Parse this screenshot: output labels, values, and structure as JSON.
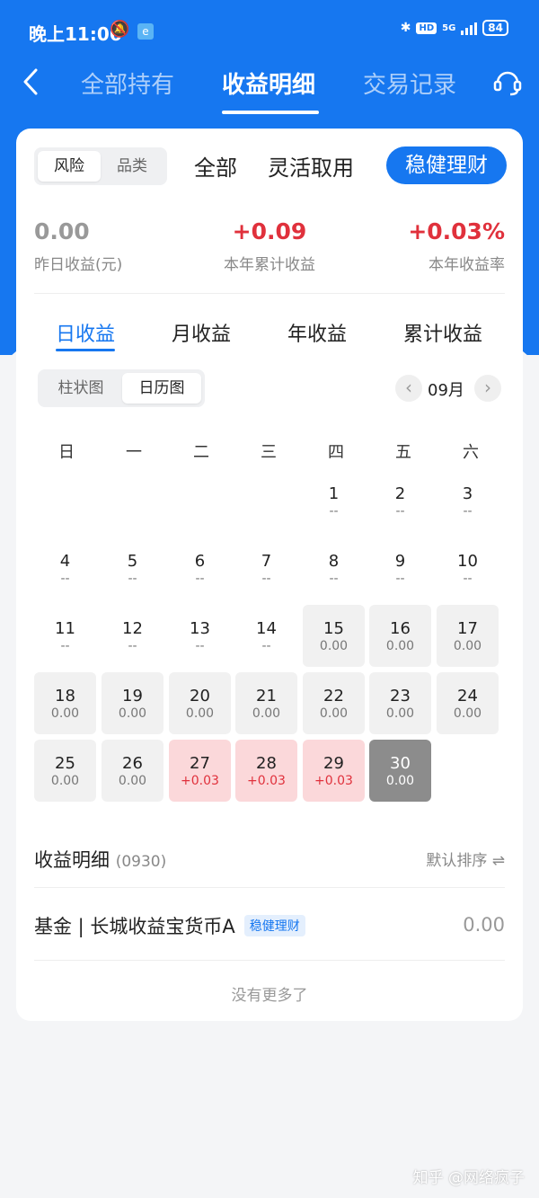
{
  "status_bar": {
    "time": "晚上11:06",
    "hd": "HD",
    "net": "5G",
    "battery": "84"
  },
  "nav": {
    "tabs": [
      "全部持有",
      "收益明细",
      "交易记录"
    ],
    "active": 1
  },
  "filter": {
    "segment": [
      "风险",
      "品类"
    ],
    "tabs": [
      "全部",
      "灵活取用",
      "稳健理财"
    ]
  },
  "summary": [
    {
      "value": "0.00",
      "label": "昨日收益(元)"
    },
    {
      "value": "+0.09",
      "label": "本年累计收益"
    },
    {
      "value": "+0.03%",
      "label": "本年收益率"
    }
  ],
  "period_tabs": [
    "日收益",
    "月收益",
    "年收益",
    "累计收益"
  ],
  "view_toggle": [
    "柱状图",
    "日历图"
  ],
  "month": {
    "label": "09月",
    "prev": "‹",
    "next": "›"
  },
  "weekdays": [
    "日",
    "一",
    "二",
    "三",
    "四",
    "五",
    "六"
  ],
  "calendar": [
    {
      "d": "1",
      "v": "--"
    },
    {
      "d": "2",
      "v": "--"
    },
    {
      "d": "3",
      "v": "--"
    },
    {
      "d": "4",
      "v": "--"
    },
    {
      "d": "5",
      "v": "--"
    },
    {
      "d": "6",
      "v": "--"
    },
    {
      "d": "7",
      "v": "--"
    },
    {
      "d": "8",
      "v": "--"
    },
    {
      "d": "9",
      "v": "--"
    },
    {
      "d": "10",
      "v": "--"
    },
    {
      "d": "11",
      "v": "--"
    },
    {
      "d": "12",
      "v": "--"
    },
    {
      "d": "13",
      "v": "--"
    },
    {
      "d": "14",
      "v": "--"
    },
    {
      "d": "15",
      "v": "0.00"
    },
    {
      "d": "16",
      "v": "0.00"
    },
    {
      "d": "17",
      "v": "0.00"
    },
    {
      "d": "18",
      "v": "0.00"
    },
    {
      "d": "19",
      "v": "0.00"
    },
    {
      "d": "20",
      "v": "0.00"
    },
    {
      "d": "21",
      "v": "0.00"
    },
    {
      "d": "22",
      "v": "0.00"
    },
    {
      "d": "23",
      "v": "0.00"
    },
    {
      "d": "24",
      "v": "0.00"
    },
    {
      "d": "25",
      "v": "0.00"
    },
    {
      "d": "26",
      "v": "0.00"
    },
    {
      "d": "27",
      "v": "+0.03"
    },
    {
      "d": "28",
      "v": "+0.03"
    },
    {
      "d": "29",
      "v": "+0.03"
    },
    {
      "d": "30",
      "v": "0.00"
    }
  ],
  "detail": {
    "title": "收益明细",
    "code": "(0930)",
    "sort_label": "默认排序 ⇌",
    "fund_name": "基金 | 长城收益宝货币A",
    "fund_tag": "稳健理财",
    "fund_value": "0.00",
    "no_more": "没有更多了"
  },
  "watermark": "知乎 @网络疯子",
  "colors": {
    "primary": "#1677f0",
    "positive": "#e0313c",
    "selected_day": "#8c8c8c"
  },
  "icons": [
    "back-arrow-icon",
    "customer-service-icon",
    "bluetooth-icon",
    "mute-bell-icon"
  ]
}
